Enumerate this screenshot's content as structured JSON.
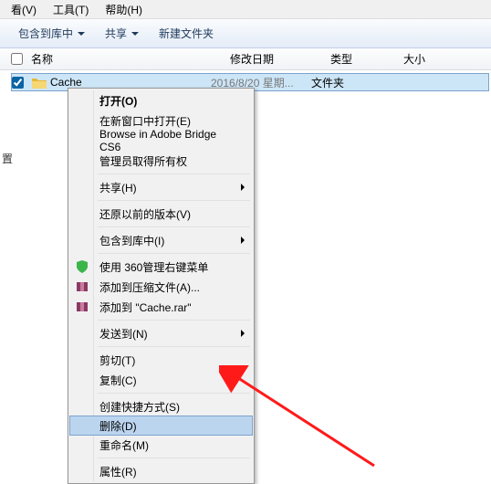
{
  "menubar": {
    "view": "看(V)",
    "tools": "工具(T)",
    "help": "帮助(H)"
  },
  "toolbar": {
    "include": "包含到库中",
    "share": "共享",
    "newfolder": "新建文件夹"
  },
  "columns": {
    "name": "名称",
    "date": "修改日期",
    "type": "类型",
    "size": "大小"
  },
  "file": {
    "name": "Cache",
    "date": "2016/8/20 星期...",
    "type": "文件夹"
  },
  "sidebar": {
    "letter": "置"
  },
  "menu": {
    "open": "打开(O)",
    "open_new_window": "在新窗口中打开(E)",
    "browse_bridge": "Browse in Adobe Bridge CS6",
    "admin_ownership": "管理员取得所有权",
    "share": "共享(H)",
    "restore_versions": "还原以前的版本(V)",
    "include_library": "包含到库中(I)",
    "manage_360": "使用 360管理右键菜单",
    "add_archive": "添加到压缩文件(A)...",
    "add_cache_rar": "添加到 \"Cache.rar\"",
    "send_to": "发送到(N)",
    "cut": "剪切(T)",
    "copy": "复制(C)",
    "create_shortcut": "创建快捷方式(S)",
    "delete": "删除(D)",
    "rename": "重命名(M)",
    "properties": "属性(R)"
  }
}
